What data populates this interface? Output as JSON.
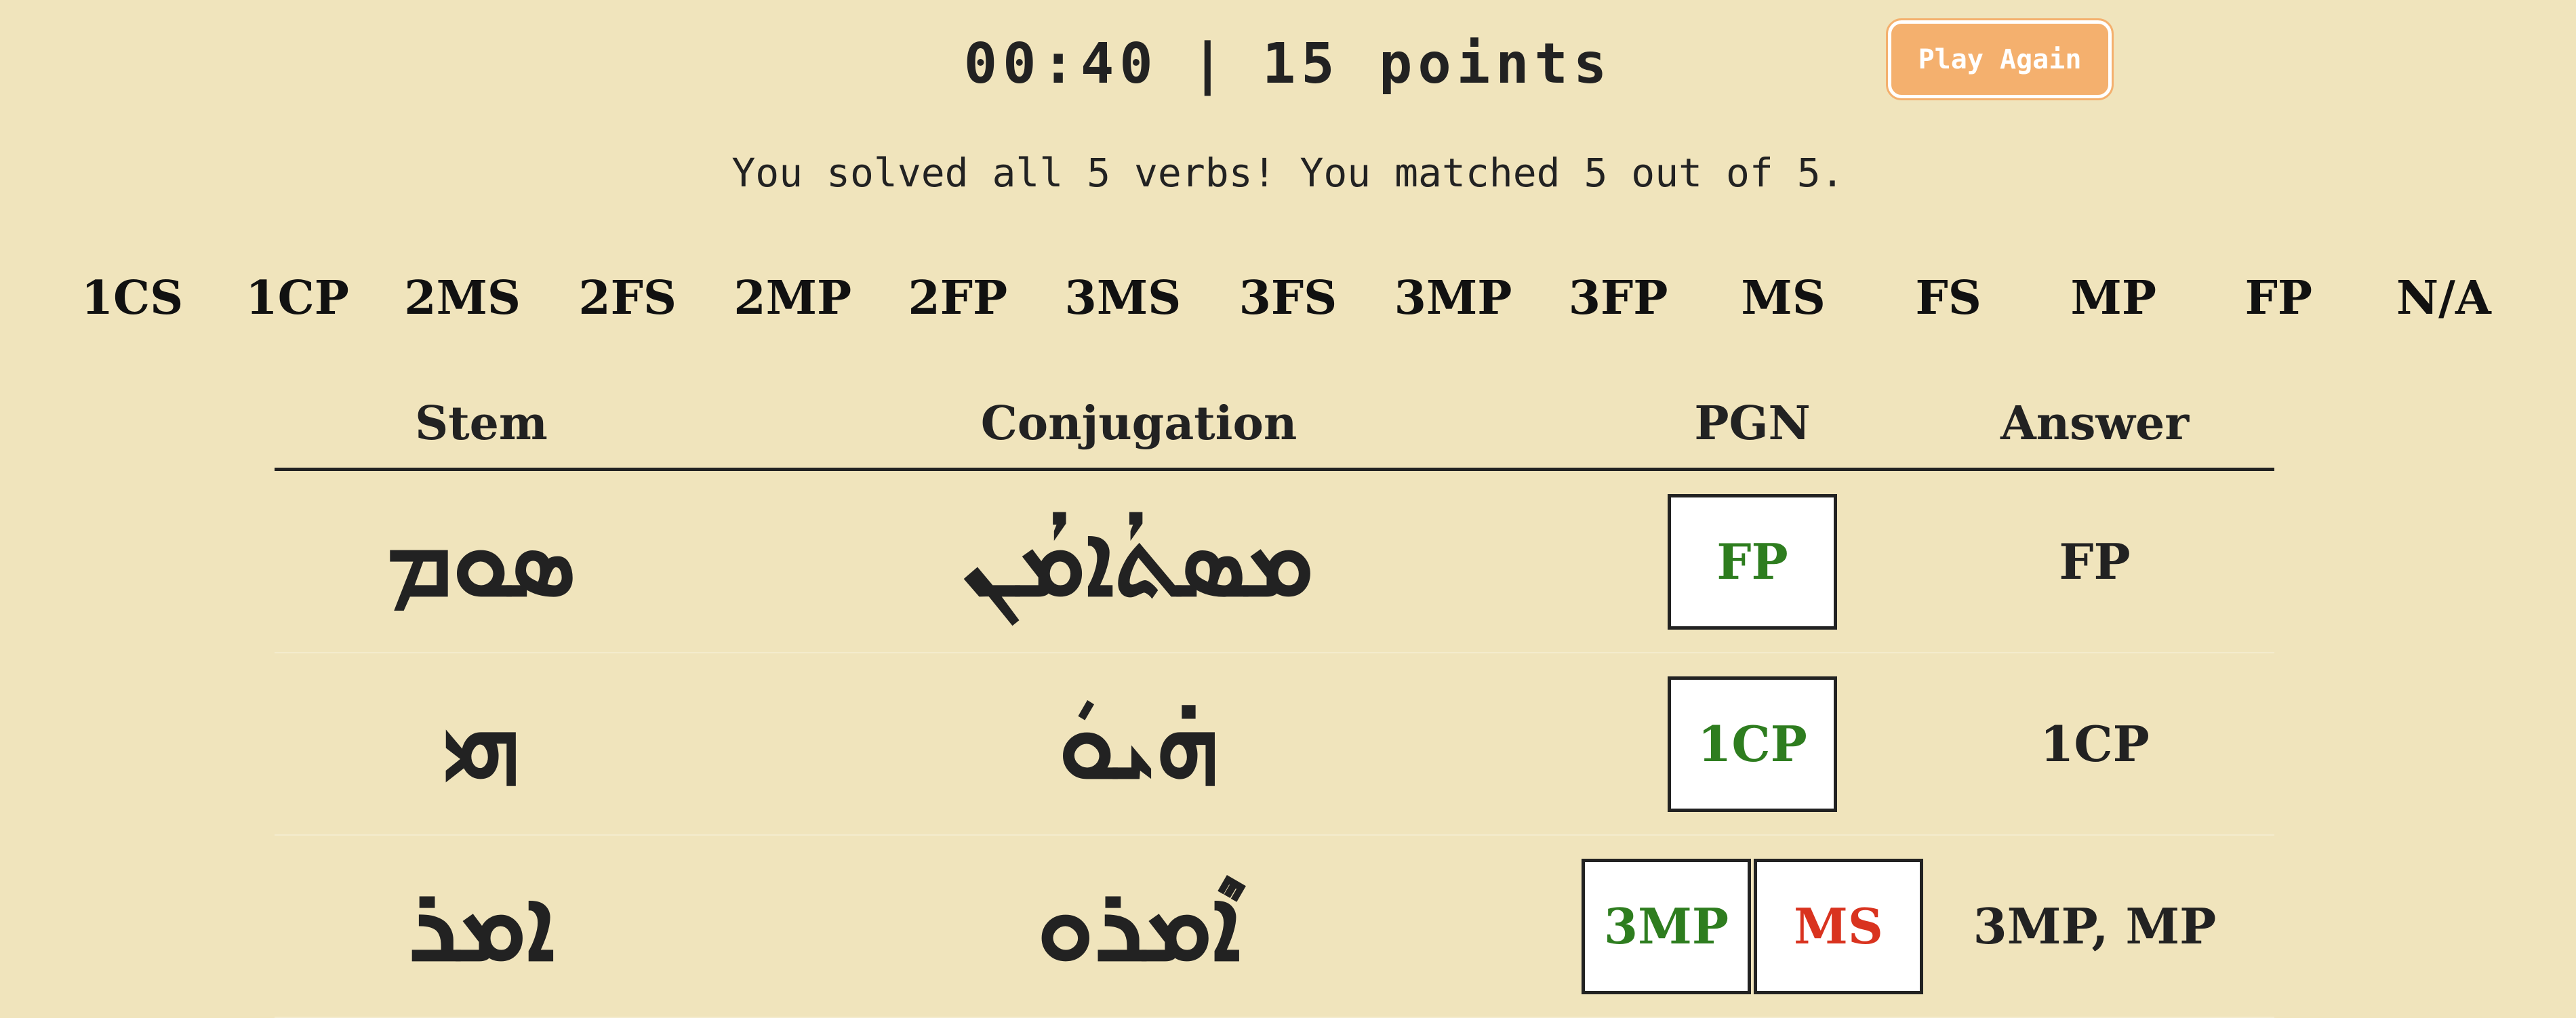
{
  "header": {
    "timer": "00:40",
    "separator": "|",
    "score": "15 points",
    "play_again_label": "Play Again"
  },
  "message": "You solved all 5 verbs! You matched 5 out of 5.",
  "pgn_options": [
    "1CS",
    "1CP",
    "2MS",
    "2FS",
    "2MP",
    "2FP",
    "3MS",
    "3FS",
    "3MP",
    "3FP",
    "MS",
    "FS",
    "MP",
    "FP",
    "N/A"
  ],
  "table": {
    "headers": {
      "stem": "Stem",
      "conjugation": "Conjugation",
      "pgn": "PGN",
      "answer": "Answer"
    },
    "rows": [
      {
        "stem": "ܣܘܡ",
        "conjugation": "ܡܣܬܳܐܡܳܢ",
        "pgn": [
          {
            "label": "FP",
            "color": "#2e7d1f"
          }
        ],
        "answer": "FP"
      },
      {
        "stem": "ܗܝ",
        "conjugation": "ܗ̇ܝܘܿ",
        "pgn": [
          {
            "label": "1CP",
            "color": "#2e7d1f"
          }
        ],
        "answer": "1CP"
      },
      {
        "stem": "ܐܡܪ",
        "conjugation": "ܐܶܡܪܘ",
        "pgn": [
          {
            "label": "3MP",
            "color": "#2e7d1f"
          },
          {
            "label": "MS",
            "color": "#d9331f"
          }
        ],
        "answer": "3MP, MP"
      }
    ]
  }
}
